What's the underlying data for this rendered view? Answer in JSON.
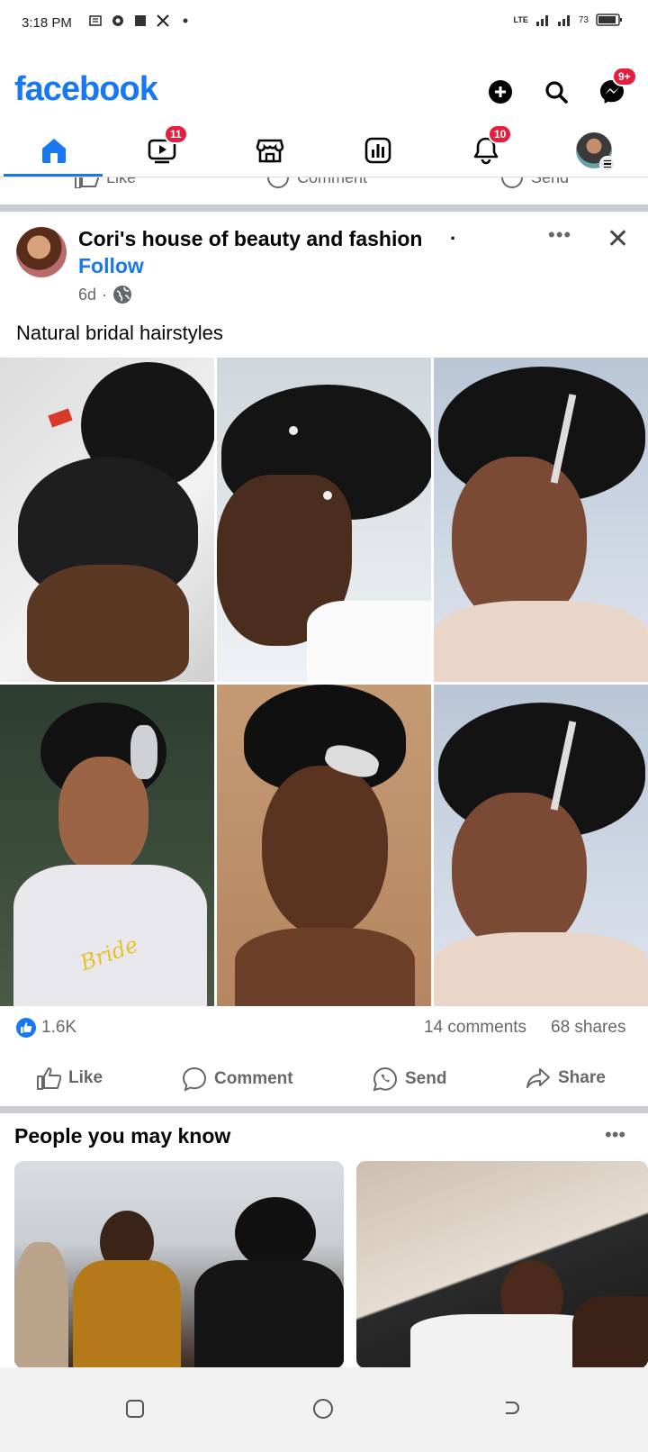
{
  "status_bar": {
    "time": "3:18 PM",
    "battery": "73",
    "network": "LTE"
  },
  "header": {
    "logo": "facebook",
    "messenger_badge": "9+",
    "icons": [
      "plus-icon",
      "search-icon",
      "messenger-icon"
    ]
  },
  "nav": {
    "video_badge": "11",
    "notifications_badge": "10",
    "tabs": [
      "home",
      "video",
      "marketplace",
      "feeds",
      "notifications",
      "profile"
    ]
  },
  "previous_post": {
    "like": "Like",
    "comment": "Comment",
    "send": "Send"
  },
  "post": {
    "author": "Cori's house of beauty and fashion",
    "follow": "Follow",
    "time": "6d",
    "text": "Natural bridal  hairstyles",
    "reactions": "1.6K",
    "comments": "14 comments",
    "shares": "68 shares",
    "actions": {
      "like": "Like",
      "comment": "Comment",
      "send": "Send",
      "share": "Share"
    }
  },
  "pymk": {
    "title": "People you may know"
  },
  "colors": {
    "brand": "#1877f2",
    "badge": "#e41e3f"
  }
}
